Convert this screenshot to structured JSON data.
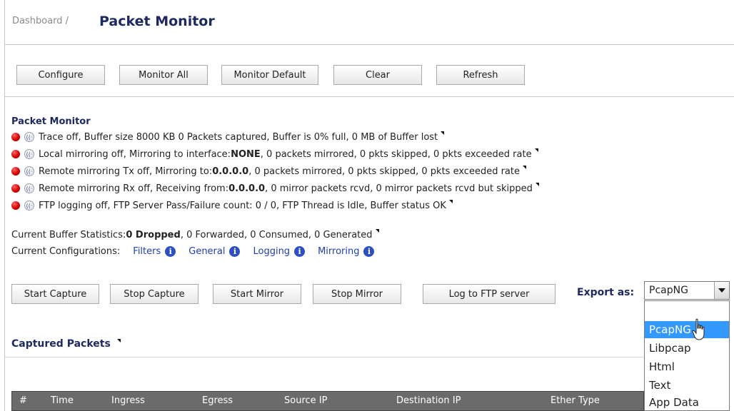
{
  "breadcrumb": {
    "parent": "Dashboard /",
    "title": "Packet Monitor"
  },
  "toolbar": {
    "configure": "Configure",
    "monitor_all": "Monitor All",
    "monitor_default": "Monitor Default",
    "clear": "Clear",
    "refresh": "Refresh"
  },
  "section": {
    "title": "Packet Monitor"
  },
  "status_lines": [
    {
      "pre": "Trace off,  Buffer size 8000 KB  0 Packets captured,  Buffer is 0% full,  0 MB of Buffer lost",
      "bold": "",
      "post": ""
    },
    {
      "pre": "Local mirroring off,  Mirroring to interface:",
      "bold": "NONE",
      "post": ",  0 packets mirrored,  0 pkts skipped,  0 pkts exceeded rate"
    },
    {
      "pre": "Remote mirroring Tx off,  Mirroring to: ",
      "bold": "0.0.0.0",
      "post": ",  0 packets mirrored,  0 pkts skipped,  0 pkts exceeded rate"
    },
    {
      "pre": "Remote mirroring Rx off,  Receiving from: ",
      "bold": "0.0.0.0",
      "post": ",  0 mirror packets rcvd,  0 mirror packets rcvd but skipped"
    },
    {
      "pre": "FTP logging off,  FTP Server Pass/Failure count: 0 / 0,  FTP Thread is Idle,  Buffer status OK",
      "bold": "",
      "post": ""
    }
  ],
  "buffer_stats": {
    "label": "Current Buffer Statistics: ",
    "dropped": "0 Dropped",
    "rest": ", 0 Forwarded, 0 Consumed, 0 Generated"
  },
  "configurations": {
    "label": "Current Configurations:",
    "filters": "Filters",
    "general": "General",
    "logging": "Logging",
    "mirroring": "Mirroring"
  },
  "capture_buttons": {
    "start_capture": "Start Capture",
    "stop_capture": "Stop Capture",
    "start_mirror": "Start Mirror",
    "stop_mirror": "Stop Mirror",
    "log_ftp": "Log to FTP server"
  },
  "export": {
    "label": "Export as:",
    "selected": "PcapNG",
    "options": [
      "PcapNG",
      "Libpcap",
      "Html",
      "Text",
      "App Data"
    ]
  },
  "captured": {
    "title": "Captured Packets"
  },
  "table_columns": [
    "#",
    "Time",
    "Ingress",
    "Egress",
    "Source IP",
    "Destination IP",
    "Ether Type"
  ],
  "colors": {
    "title_navy": "#1d2a62",
    "link_blue": "#1f3fb0",
    "header_gray": "#6b6b6b",
    "selection_blue": "#3399ff",
    "status_red": "#d40000"
  },
  "icons": [
    "status-off-icon",
    "signal-icon",
    "info-icon",
    "menu-triangle-icon",
    "dropdown-arrow-icon",
    "mouse-cursor-icon"
  ]
}
